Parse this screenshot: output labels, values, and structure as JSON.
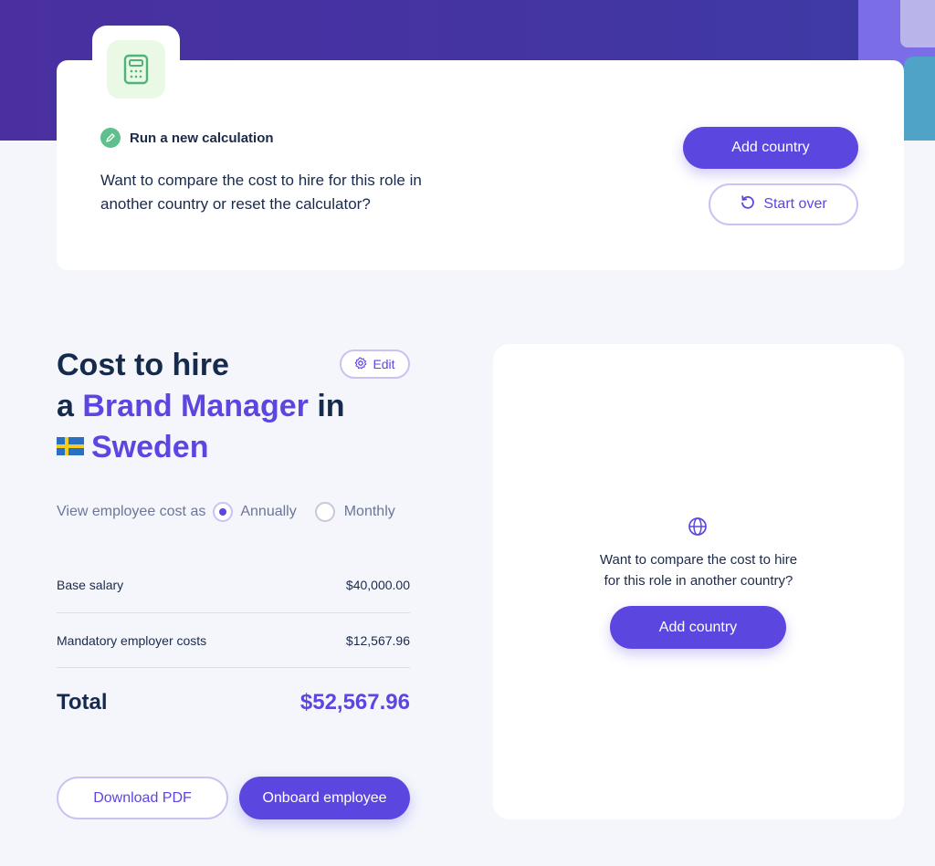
{
  "calculation": {
    "run_label": "Run a new calculation",
    "description": "Want to compare the cost to hire for this role in another country or reset the calculator?",
    "add_country_label": "Add country",
    "start_over_label": "Start over"
  },
  "cost": {
    "title_prefix": "Cost to hire",
    "article": "a",
    "role": "Brand Manager",
    "preposition": "in",
    "country": "Sweden",
    "edit_label": "Edit",
    "view_label": "View employee cost as",
    "period_options": [
      "Annually",
      "Monthly"
    ],
    "selected_period": "Annually",
    "rows": [
      {
        "label": "Base salary",
        "value": "$40,000.00"
      },
      {
        "label": "Mandatory employer costs",
        "value": "$12,567.96"
      }
    ],
    "total_label": "Total",
    "total_value": "$52,567.96",
    "download_label": "Download PDF",
    "onboard_label": "Onboard employee"
  },
  "compare": {
    "text_line1": "Want to compare the cost to hire",
    "text_line2": "for this role in another country?",
    "add_country_label": "Add country"
  },
  "colors": {
    "brand": "#5b47e0",
    "hero": "#4236a3",
    "success": "#5ec08c"
  },
  "icons": {
    "calculator": "calculator-icon",
    "pencil": "pencil-icon",
    "restart": "restart-icon",
    "gear": "gear-icon",
    "flag": "sweden-flag-icon",
    "globe": "globe-icon"
  }
}
